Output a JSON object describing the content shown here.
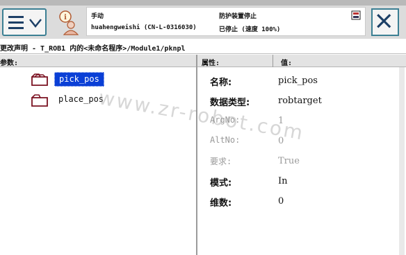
{
  "status": {
    "mode": "手动",
    "controller": "huahengweishi (CN-L-0316030)",
    "state": "防护装置停止",
    "speed": "已停止 (速度 100%)"
  },
  "path": "更改声明 - T_ROB1 内的<未命名程序>/Module1/pknpl",
  "left_header": "参数:",
  "tree": [
    {
      "label": "pick_pos",
      "selected": true
    },
    {
      "label": "place_pos",
      "selected": false
    }
  ],
  "right_header": {
    "attr": "属性:",
    "value": "值:"
  },
  "properties": [
    {
      "name": "名称:",
      "value": "pick_pos",
      "enabled": true
    },
    {
      "name": "数据类型:",
      "value": "robtarget",
      "enabled": true
    },
    {
      "name": "ArgNo:",
      "value": "1",
      "enabled": false
    },
    {
      "name": "AltNo:",
      "value": "0",
      "enabled": false
    },
    {
      "name": "要求:",
      "value": "True",
      "enabled": false
    },
    {
      "name": "模式:",
      "value": "In",
      "enabled": true
    },
    {
      "name": "维数:",
      "value": "0",
      "enabled": true
    }
  ],
  "watermark": "www.zr-robot.com",
  "icons": {
    "menu": "hamburger-menu-icon",
    "info": "user-info-icon",
    "close": "close-icon",
    "folder": "folder-icon"
  },
  "colors": {
    "selection": "#0a3fd6",
    "button_border": "#3b7f93"
  }
}
